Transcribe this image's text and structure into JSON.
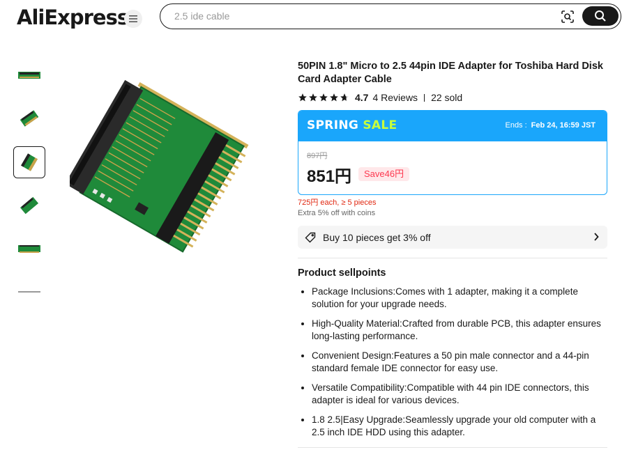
{
  "header": {
    "logo": "AliExpress",
    "search_placeholder": "2.5 ide cable",
    "icons": {
      "menu": "menu-icon",
      "camera": "image-search-icon",
      "search": "search-icon"
    }
  },
  "gallery": {
    "thumbnail_count": 6,
    "active_index": 2
  },
  "product": {
    "title": "50PIN 1.8\" Micro to 2.5 44pin IDE Adapter for Toshiba Hard Disk Card Adapter Cable",
    "rating": "4.7",
    "reviews": "4 Reviews",
    "sold": "22 sold"
  },
  "sale": {
    "title_part1": "SPRING",
    "title_part2": "SALE",
    "ends_label": "Ends :",
    "ends_value": "Feb 24, 16:59 JST",
    "old_price": "897円",
    "price": "851円",
    "save": "Save46円",
    "bulk": "725円 each, ≥ 5 pieces",
    "coins": "Extra 5% off with coins",
    "buy_more": "Buy 10 pieces get 3% off"
  },
  "sellpoints": {
    "title": "Product sellpoints",
    "items": [
      "Package Inclusions:Comes with 1 adapter, making it a complete solution for your upgrade needs.",
      "High-Quality Material:Crafted from durable PCB, this adapter ensures long-lasting performance.",
      "Convenient Design:Features a 50 pin male connector and a 44-pin standard female IDE connector for easy use.",
      "Versatile Compatibility:Compatible with 44 pin IDE connectors, this adapter is ideal for various devices.",
      "1.8 2.5|Easy Upgrade:Seamlessly upgrade your old computer with a 2.5 inch IDE HDD using this adapter."
    ]
  },
  "colors": {
    "brand_red": "#e62e04",
    "sale_blue": "#1aa6fb",
    "sale_accent": "#c8ff3c",
    "save_red": "#fd384f",
    "pcb_green": "#1f8a3a"
  }
}
